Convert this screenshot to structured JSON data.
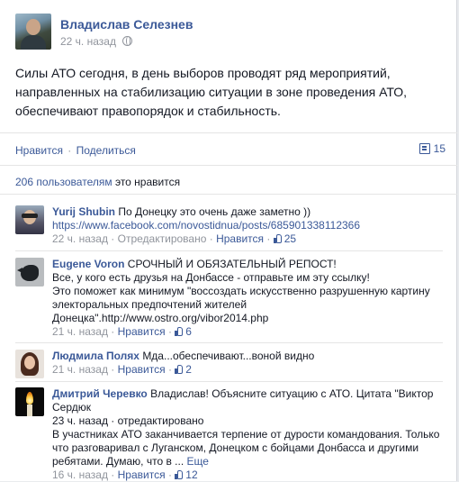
{
  "post": {
    "author": "Владислав Селезнев",
    "time": "22 ч. назад",
    "text": "Силы АТО сегодня, в день выборов проводят ряд мероприятий, направленных на стабилизацию ситуации в зоне проведения АТО, обеспечивают правопорядок и стабильность.",
    "like_label": "Нравится",
    "separator": "·",
    "share_label": "Поделиться",
    "comments_count": "15",
    "likes_count_link": "206 пользователям",
    "likes_suffix": "это нравится"
  },
  "comments": [
    {
      "name": "Yurij Shubin",
      "text": "По Донецку это очень даже заметно ))",
      "lines": [
        "https://www.facebook.com/novostidnua/posts/685901338112366"
      ],
      "time": "22 ч. назад",
      "extra": "Отредактировано",
      "like_label": "Нравится",
      "likes": "25",
      "dot": "·"
    },
    {
      "name": "Eugene Voron",
      "text": "СРОЧНЫЙ И ОБЯЗАТЕЛЬНЫЙ РЕПОСТ!",
      "lines": [
        "Все, у кого есть друзья на Донбассе - отправьте им эту ссылку!",
        "Это поможет как минимум \"воссоздать искусственно разрушенную картину электоральных предпочтений жителей",
        "Донецка\".http://www.ostro.org/vibor2014.php"
      ],
      "time": "21 ч. назад",
      "like_label": "Нравится",
      "likes": "6",
      "dot": "·"
    },
    {
      "name": "Людмила Полях",
      "text": "Мда...обеспечивают...воной видно",
      "time": "21 ч. назад",
      "like_label": "Нравится",
      "likes": "2",
      "dot": "·"
    },
    {
      "name": "Дмитрий Черевко",
      "text": "Владислав! Объясните ситуацию с АТО. Цитата \"Виктор Сердюк",
      "time_line": "23 ч. назад · отредактировано",
      "body2": "В участниках АТО заканчивается терпение от дурости командования. Только что разговаривал с Луганском, Донецком с бойцами Донбасса и другими ребятами. Думаю, что в ...",
      "more": "Еще",
      "time": "16 ч. назад",
      "like_label": "Нравится",
      "likes": "12",
      "dot": "·"
    }
  ],
  "colors": {
    "link": "#3b5998",
    "text": "#141823",
    "meta": "#90949c"
  },
  "icons": [
    "globe-icon",
    "comment-icon",
    "thumb-icon"
  ]
}
